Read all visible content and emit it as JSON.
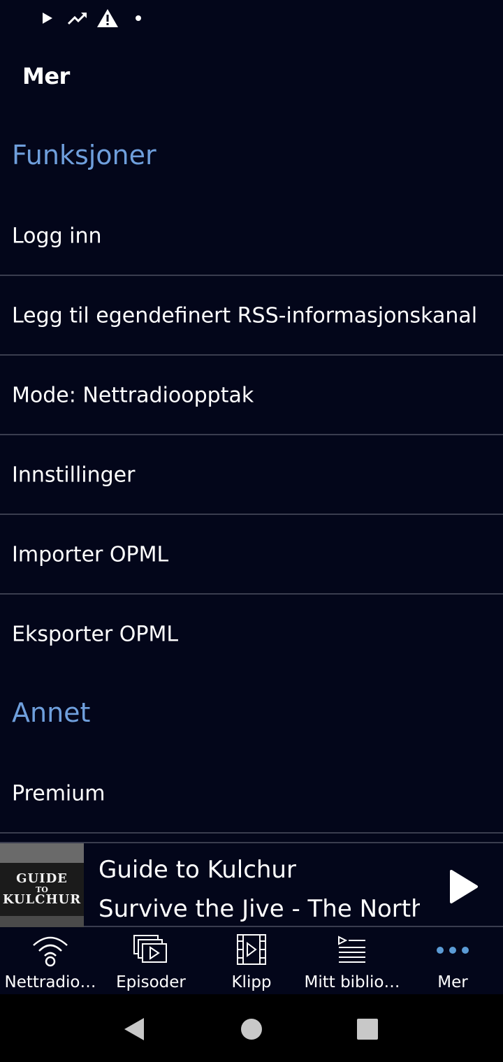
{
  "status_bar": {
    "icons": [
      "play-icon",
      "trending-icon",
      "warning-icon",
      "dot-icon"
    ]
  },
  "header": {
    "title": "Mer"
  },
  "sections": [
    {
      "title": "Funksjoner",
      "items": [
        {
          "label": "Logg inn"
        },
        {
          "label": "Legg til egendefinert RSS-informasjonskanal"
        },
        {
          "label": "Mode: Nettradioopptak"
        },
        {
          "label": "Innstillinger"
        },
        {
          "label": "Importer OPML"
        },
        {
          "label": "Eksporter OPML"
        }
      ]
    },
    {
      "title": "Annet",
      "items": [
        {
          "label": "Premium"
        }
      ]
    }
  ],
  "mini_player": {
    "cover_text": [
      "GUIDE",
      "TO",
      "KULCHUR"
    ],
    "title": "Guide to Kulchur",
    "subtitle": "Survive the Jive - The North",
    "play_icon": "play-icon"
  },
  "bottom_nav": {
    "items": [
      {
        "label": "Nettradio…",
        "icon": "wifi-radio-icon"
      },
      {
        "label": "Episoder",
        "icon": "episodes-icon"
      },
      {
        "label": "Klipp",
        "icon": "film-clip-icon"
      },
      {
        "label": "Mitt biblio…",
        "icon": "library-icon"
      },
      {
        "label": "Mer",
        "icon": "more-dots-icon",
        "active": true
      }
    ],
    "active_color": "#5b9bd5"
  },
  "system_nav": {
    "icons": [
      "back-icon",
      "home-icon",
      "recents-icon"
    ]
  },
  "colors": {
    "background": "#03061a",
    "section_header": "#6f9fdc",
    "divider": "#3a3d4f"
  }
}
